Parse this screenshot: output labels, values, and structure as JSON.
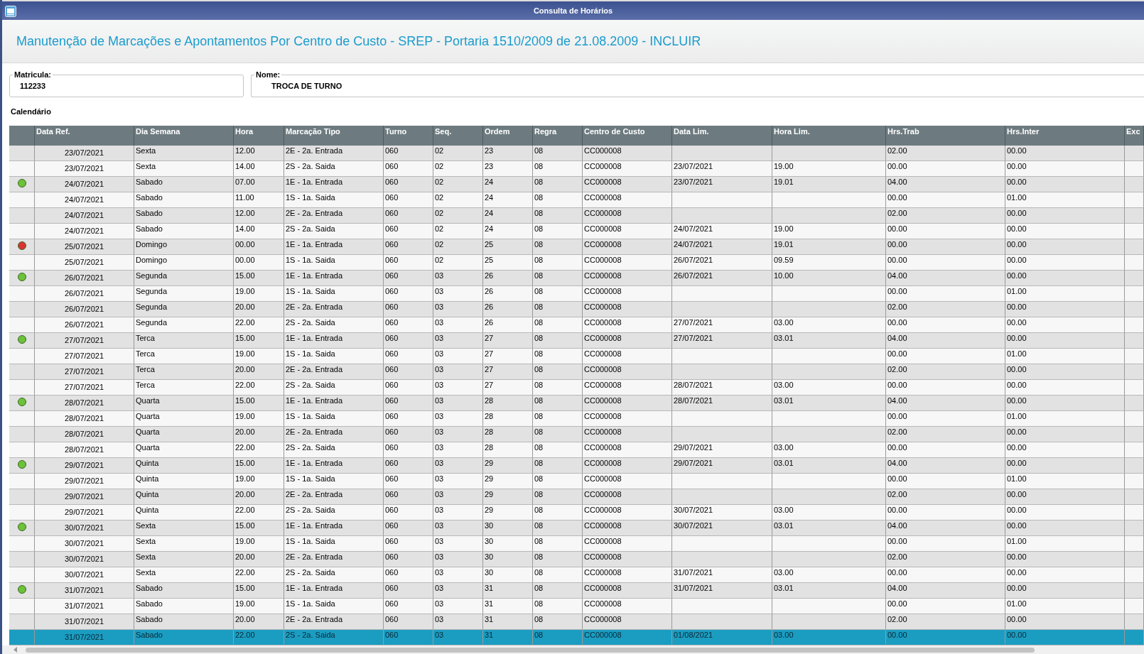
{
  "window": {
    "title": "Consulta de Horários"
  },
  "page_title": "Manutenção de Marcações e Apontamentos Por Centro de Custo - SREP - Portaria 1510/2009 de 21.08.2009 - INCLUIR",
  "fields": [
    {
      "label": "Matricula:",
      "value": "112233"
    },
    {
      "label": "Nome:",
      "value": "TROCA DE TURNO"
    }
  ],
  "section_label": "Calendário",
  "table": {
    "columns": [
      "Data Ref.",
      "Dia Semana",
      "Hora",
      "Marcação Tipo",
      "Turno",
      "Seq.",
      "Ordem",
      "Regra",
      "Centro de Custo",
      "Data Lim.",
      "Hora Lim.",
      "Hrs.Trab",
      "Hrs.Inter",
      "Exc"
    ],
    "rows": [
      {
        "selected": false,
        "cells": [
          "23/07/2021",
          "Sexta",
          "12.00",
          "2E - 2a. Entrada",
          "060",
          "02",
          "23",
          "08",
          "CC000008",
          null,
          null,
          "02.00",
          "00.00"
        ]
      },
      {
        "selected": false,
        "cells": [
          "23/07/2021",
          "Sexta",
          "14.00",
          "2S - 2a. Saida",
          "060",
          "02",
          "23",
          "08",
          "CC000008",
          "23/07/2021",
          "19.00",
          "00.00",
          "00.00"
        ]
      },
      {
        "selected": false,
        "color": "#6cc23a",
        "cells": [
          "24/07/2021",
          "Sabado",
          "07.00",
          "1E - 1a. Entrada",
          "060",
          "02",
          "24",
          "08",
          "CC000008",
          "23/07/2021",
          "19.01",
          "04.00",
          "00.00"
        ]
      },
      {
        "selected": false,
        "cells": [
          "24/07/2021",
          "Sabado",
          "11.00",
          "1S - 1a. Saida",
          "060",
          "02",
          "24",
          "08",
          "CC000008",
          null,
          null,
          "00.00",
          "01.00"
        ]
      },
      {
        "selected": false,
        "cells": [
          "24/07/2021",
          "Sabado",
          "12.00",
          "2E - 2a. Entrada",
          "060",
          "02",
          "24",
          "08",
          "CC000008",
          null,
          null,
          "02.00",
          "00.00"
        ]
      },
      {
        "selected": false,
        "cells": [
          "24/07/2021",
          "Sabado",
          "14.00",
          "2S - 2a. Saida",
          "060",
          "02",
          "24",
          "08",
          "CC000008",
          "24/07/2021",
          "19.00",
          "00.00",
          "00.00"
        ]
      },
      {
        "selected": false,
        "color": "#d83434",
        "cells": [
          "25/07/2021",
          "Domingo",
          "00.00",
          "1E - 1a. Entrada",
          "060",
          "02",
          "25",
          "08",
          "CC000008",
          "24/07/2021",
          "19.01",
          "00.00",
          "00.00"
        ]
      },
      {
        "selected": false,
        "cells": [
          "25/07/2021",
          "Domingo",
          "00.00",
          "1S - 1a. Saida",
          "060",
          "02",
          "25",
          "08",
          "CC000008",
          "26/07/2021",
          "09.59",
          "00.00",
          "00.00"
        ]
      },
      {
        "selected": false,
        "color": "#6cc23a",
        "cells": [
          "26/07/2021",
          "Segunda",
          "15.00",
          "1E - 1a. Entrada",
          "060",
          "03",
          "26",
          "08",
          "CC000008",
          "26/07/2021",
          "10.00",
          "04.00",
          "00.00"
        ]
      },
      {
        "selected": false,
        "cells": [
          "26/07/2021",
          "Segunda",
          "19.00",
          "1S - 1a. Saida",
          "060",
          "03",
          "26",
          "08",
          "CC000008",
          null,
          null,
          "00.00",
          "01.00"
        ]
      },
      {
        "selected": false,
        "cells": [
          "26/07/2021",
          "Segunda",
          "20.00",
          "2E - 2a. Entrada",
          "060",
          "03",
          "26",
          "08",
          "CC000008",
          null,
          null,
          "02.00",
          "00.00"
        ]
      },
      {
        "selected": false,
        "cells": [
          "26/07/2021",
          "Segunda",
          "22.00",
          "2S - 2a. Saida",
          "060",
          "03",
          "26",
          "08",
          "CC000008",
          "27/07/2021",
          "03.00",
          "00.00",
          "00.00"
        ]
      },
      {
        "selected": false,
        "color": "#6cc23a",
        "cells": [
          "27/07/2021",
          "Terca",
          "15.00",
          "1E - 1a. Entrada",
          "060",
          "03",
          "27",
          "08",
          "CC000008",
          "27/07/2021",
          "03.01",
          "04.00",
          "00.00"
        ]
      },
      {
        "selected": false,
        "cells": [
          "27/07/2021",
          "Terca",
          "19.00",
          "1S - 1a. Saida",
          "060",
          "03",
          "27",
          "08",
          "CC000008",
          null,
          null,
          "00.00",
          "01.00"
        ]
      },
      {
        "selected": false,
        "cells": [
          "27/07/2021",
          "Terca",
          "20.00",
          "2E - 2a. Entrada",
          "060",
          "03",
          "27",
          "08",
          "CC000008",
          null,
          null,
          "02.00",
          "00.00"
        ]
      },
      {
        "selected": false,
        "cells": [
          "27/07/2021",
          "Terca",
          "22.00",
          "2S - 2a. Saida",
          "060",
          "03",
          "27",
          "08",
          "CC000008",
          "28/07/2021",
          "03.00",
          "00.00",
          "00.00"
        ]
      },
      {
        "selected": false,
        "color": "#6cc23a",
        "cells": [
          "28/07/2021",
          "Quarta",
          "15.00",
          "1E - 1a. Entrada",
          "060",
          "03",
          "28",
          "08",
          "CC000008",
          "28/07/2021",
          "03.01",
          "04.00",
          "00.00"
        ]
      },
      {
        "selected": false,
        "cells": [
          "28/07/2021",
          "Quarta",
          "19.00",
          "1S - 1a. Saida",
          "060",
          "03",
          "28",
          "08",
          "CC000008",
          null,
          null,
          "00.00",
          "01.00"
        ]
      },
      {
        "selected": false,
        "cells": [
          "28/07/2021",
          "Quarta",
          "20.00",
          "2E - 2a. Entrada",
          "060",
          "03",
          "28",
          "08",
          "CC000008",
          null,
          null,
          "02.00",
          "00.00"
        ]
      },
      {
        "selected": false,
        "cells": [
          "28/07/2021",
          "Quarta",
          "22.00",
          "2S - 2a. Saida",
          "060",
          "03",
          "28",
          "08",
          "CC000008",
          "29/07/2021",
          "03.00",
          "00.00",
          "00.00"
        ]
      },
      {
        "selected": false,
        "color": "#6cc23a",
        "cells": [
          "29/07/2021",
          "Quinta",
          "15.00",
          "1E - 1a. Entrada",
          "060",
          "03",
          "29",
          "08",
          "CC000008",
          "29/07/2021",
          "03.01",
          "04.00",
          "00.00"
        ]
      },
      {
        "selected": false,
        "cells": [
          "29/07/2021",
          "Quinta",
          "19.00",
          "1S - 1a. Saida",
          "060",
          "03",
          "29",
          "08",
          "CC000008",
          null,
          null,
          "00.00",
          "01.00"
        ]
      },
      {
        "selected": false,
        "cells": [
          "29/07/2021",
          "Quinta",
          "20.00",
          "2E - 2a. Entrada",
          "060",
          "03",
          "29",
          "08",
          "CC000008",
          null,
          null,
          "02.00",
          "00.00"
        ]
      },
      {
        "selected": false,
        "cells": [
          "29/07/2021",
          "Quinta",
          "22.00",
          "2S - 2a. Saida",
          "060",
          "03",
          "29",
          "08",
          "CC000008",
          "30/07/2021",
          "03.00",
          "00.00",
          "00.00"
        ]
      },
      {
        "selected": false,
        "color": "#6cc23a",
        "cells": [
          "30/07/2021",
          "Sexta",
          "15.00",
          "1E - 1a. Entrada",
          "060",
          "03",
          "30",
          "08",
          "CC000008",
          "30/07/2021",
          "03.01",
          "04.00",
          "00.00"
        ]
      },
      {
        "selected": false,
        "cells": [
          "30/07/2021",
          "Sexta",
          "19.00",
          "1S - 1a. Saida",
          "060",
          "03",
          "30",
          "08",
          "CC000008",
          null,
          null,
          "00.00",
          "01.00"
        ]
      },
      {
        "selected": false,
        "cells": [
          "30/07/2021",
          "Sexta",
          "20.00",
          "2E - 2a. Entrada",
          "060",
          "03",
          "30",
          "08",
          "CC000008",
          null,
          null,
          "02.00",
          "00.00"
        ]
      },
      {
        "selected": false,
        "cells": [
          "30/07/2021",
          "Sexta",
          "22.00",
          "2S - 2a. Saida",
          "060",
          "03",
          "30",
          "08",
          "CC000008",
          "31/07/2021",
          "03.00",
          "00.00",
          "00.00"
        ]
      },
      {
        "selected": false,
        "color": "#6cc23a",
        "cells": [
          "31/07/2021",
          "Sabado",
          "15.00",
          "1E - 1a. Entrada",
          "060",
          "03",
          "31",
          "08",
          "CC000008",
          "31/07/2021",
          "03.01",
          "04.00",
          "00.00"
        ]
      },
      {
        "selected": false,
        "cells": [
          "31/07/2021",
          "Sabado",
          "19.00",
          "1S - 1a. Saida",
          "060",
          "03",
          "31",
          "08",
          "CC000008",
          null,
          null,
          "00.00",
          "01.00"
        ]
      },
      {
        "selected": false,
        "cells": [
          "31/07/2021",
          "Sabado",
          "20.00",
          "2E - 2a. Entrada",
          "060",
          "03",
          "31",
          "08",
          "CC000008",
          null,
          null,
          "02.00",
          "00.00"
        ]
      },
      {
        "selected": true,
        "cells": [
          "31/07/2021",
          "Sabado",
          "22.00",
          "2S - 2a. Saida",
          "060",
          "03",
          "31",
          "08",
          "CC000008",
          "01/08/2021",
          "03.00",
          "00.00",
          "00.00"
        ]
      }
    ]
  }
}
